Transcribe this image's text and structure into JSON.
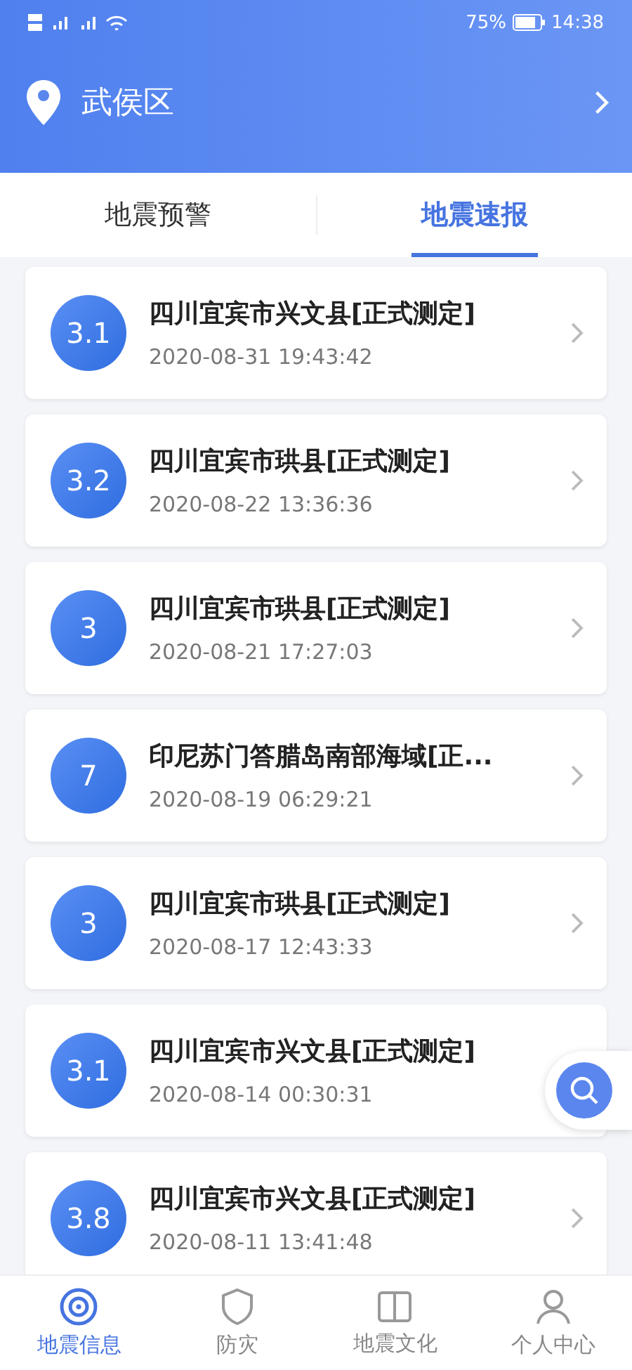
{
  "status_bar": {
    "battery": "75%",
    "time": "14:38"
  },
  "header": {
    "location": "武侯区"
  },
  "tabs": [
    {
      "label": "地震预警",
      "selected": false
    },
    {
      "label": "地震速报",
      "selected": true
    }
  ],
  "quakes": [
    {
      "magnitude": "3.1",
      "place": "四川宜宾市兴文县[正式测定]",
      "time": "2020-08-31 19:43:42"
    },
    {
      "magnitude": "3.2",
      "place": "四川宜宾市珙县[正式测定]",
      "time": "2020-08-22 13:36:36"
    },
    {
      "magnitude": "3",
      "place": "四川宜宾市珙县[正式测定]",
      "time": "2020-08-21 17:27:03"
    },
    {
      "magnitude": "7",
      "place": "印尼苏门答腊岛南部海域[正...",
      "time": "2020-08-19 06:29:21"
    },
    {
      "magnitude": "3",
      "place": "四川宜宾市珙县[正式测定]",
      "time": "2020-08-17 12:43:33"
    },
    {
      "magnitude": "3.1",
      "place": "四川宜宾市兴文县[正式测定]",
      "time": "2020-08-14 00:30:31"
    },
    {
      "magnitude": "3.8",
      "place": "四川宜宾市兴文县[正式测定]",
      "time": "2020-08-11 13:41:48"
    }
  ],
  "nav": [
    {
      "label": "地震信息",
      "selected": true
    },
    {
      "label": "防灾",
      "selected": false
    },
    {
      "label": "地震文化",
      "selected": false
    },
    {
      "label": "个人中心",
      "selected": false
    }
  ]
}
